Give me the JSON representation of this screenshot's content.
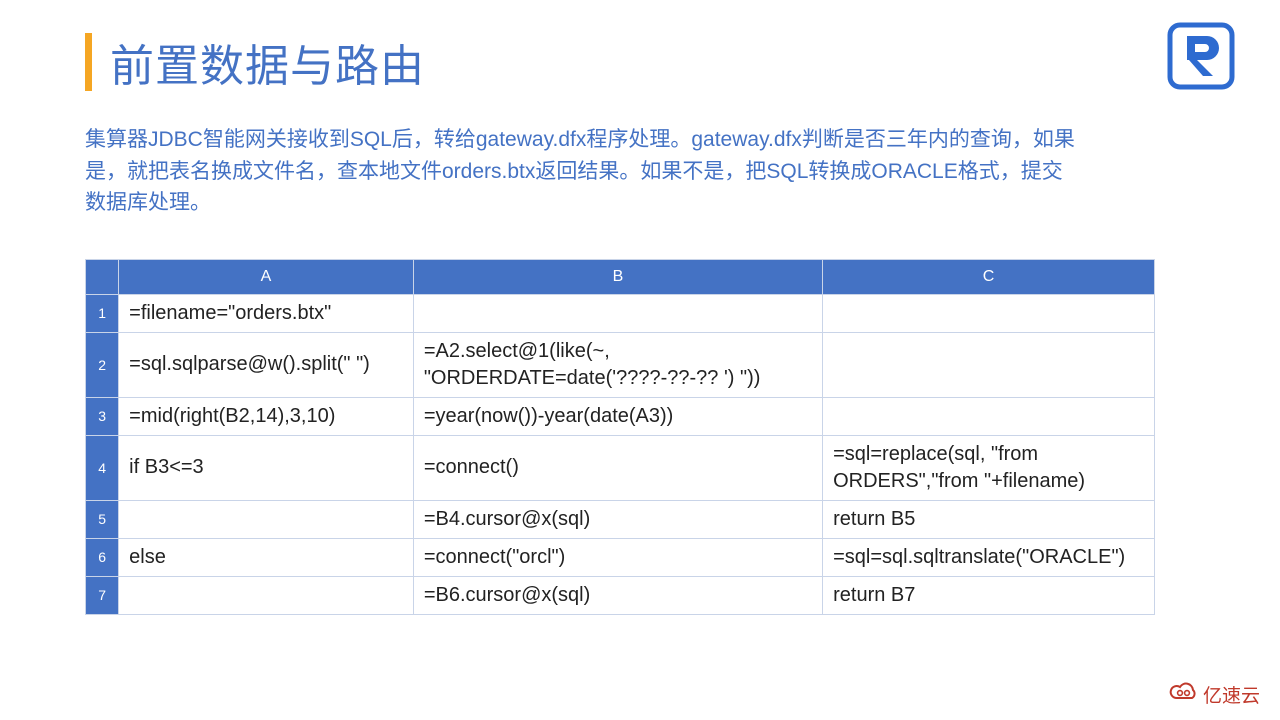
{
  "title": "前置数据与路由",
  "description": "集算器JDBC智能网关接收到SQL后，转给gateway.dfx程序处理。gateway.dfx判断是否三年内的查询，如果是，就把表名换成文件名，查本地文件orders.btx返回结果。如果不是，把SQL转换成ORACLE格式，提交数据库处理。",
  "columns": {
    "corner": "",
    "A": "A",
    "B": "B",
    "C": "C"
  },
  "rows": [
    {
      "n": "1",
      "A": "=filename=\"orders.btx\"",
      "B": "",
      "C": ""
    },
    {
      "n": "2",
      "A": "=sql.sqlparse@w().split(\" \")",
      "B": "=A2.select@1(like(~, \"ORDERDATE=date('????-??-?? ') \"))",
      "C": ""
    },
    {
      "n": "3",
      "A": "=mid(right(B2,14),3,10)",
      "B": "=year(now())-year(date(A3))",
      "C": ""
    },
    {
      "n": "4",
      "A": "if B3<=3",
      "B": "=connect()",
      "C": "=sql=replace(sql, \"from ORDERS\",\"from  \"+filename)"
    },
    {
      "n": "5",
      "A": "",
      "B": "=B4.cursor@x(sql)",
      "C": "return B5"
    },
    {
      "n": "6",
      "A": "else",
      "B": "=connect(\"orcl\")",
      "C": "=sql=sql.sqltranslate(\"ORACLE\")"
    },
    {
      "n": "7",
      "A": "",
      "B": "=B6.cursor@x(sql)",
      "C": "return B7"
    }
  ],
  "watermark": "亿速云",
  "chart_data": {
    "type": "table",
    "title": "前置数据与路由",
    "columns": [
      "A",
      "B",
      "C"
    ],
    "data": [
      [
        "=filename=\"orders.btx\"",
        "",
        ""
      ],
      [
        "=sql.sqlparse@w().split(\" \")",
        "=A2.select@1(like(~, \"ORDERDATE=date('????-??-?? ') \"))",
        ""
      ],
      [
        "=mid(right(B2,14),3,10)",
        "=year(now())-year(date(A3))",
        ""
      ],
      [
        "if B3<=3",
        "=connect()",
        "=sql=replace(sql, \"from ORDERS\",\"from  \"+filename)"
      ],
      [
        "",
        "=B4.cursor@x(sql)",
        "return B5"
      ],
      [
        "else",
        "=connect(\"orcl\")",
        "=sql=sql.sqltranslate(\"ORACLE\")"
      ],
      [
        "",
        "=B6.cursor@x(sql)",
        "return B7"
      ]
    ]
  }
}
